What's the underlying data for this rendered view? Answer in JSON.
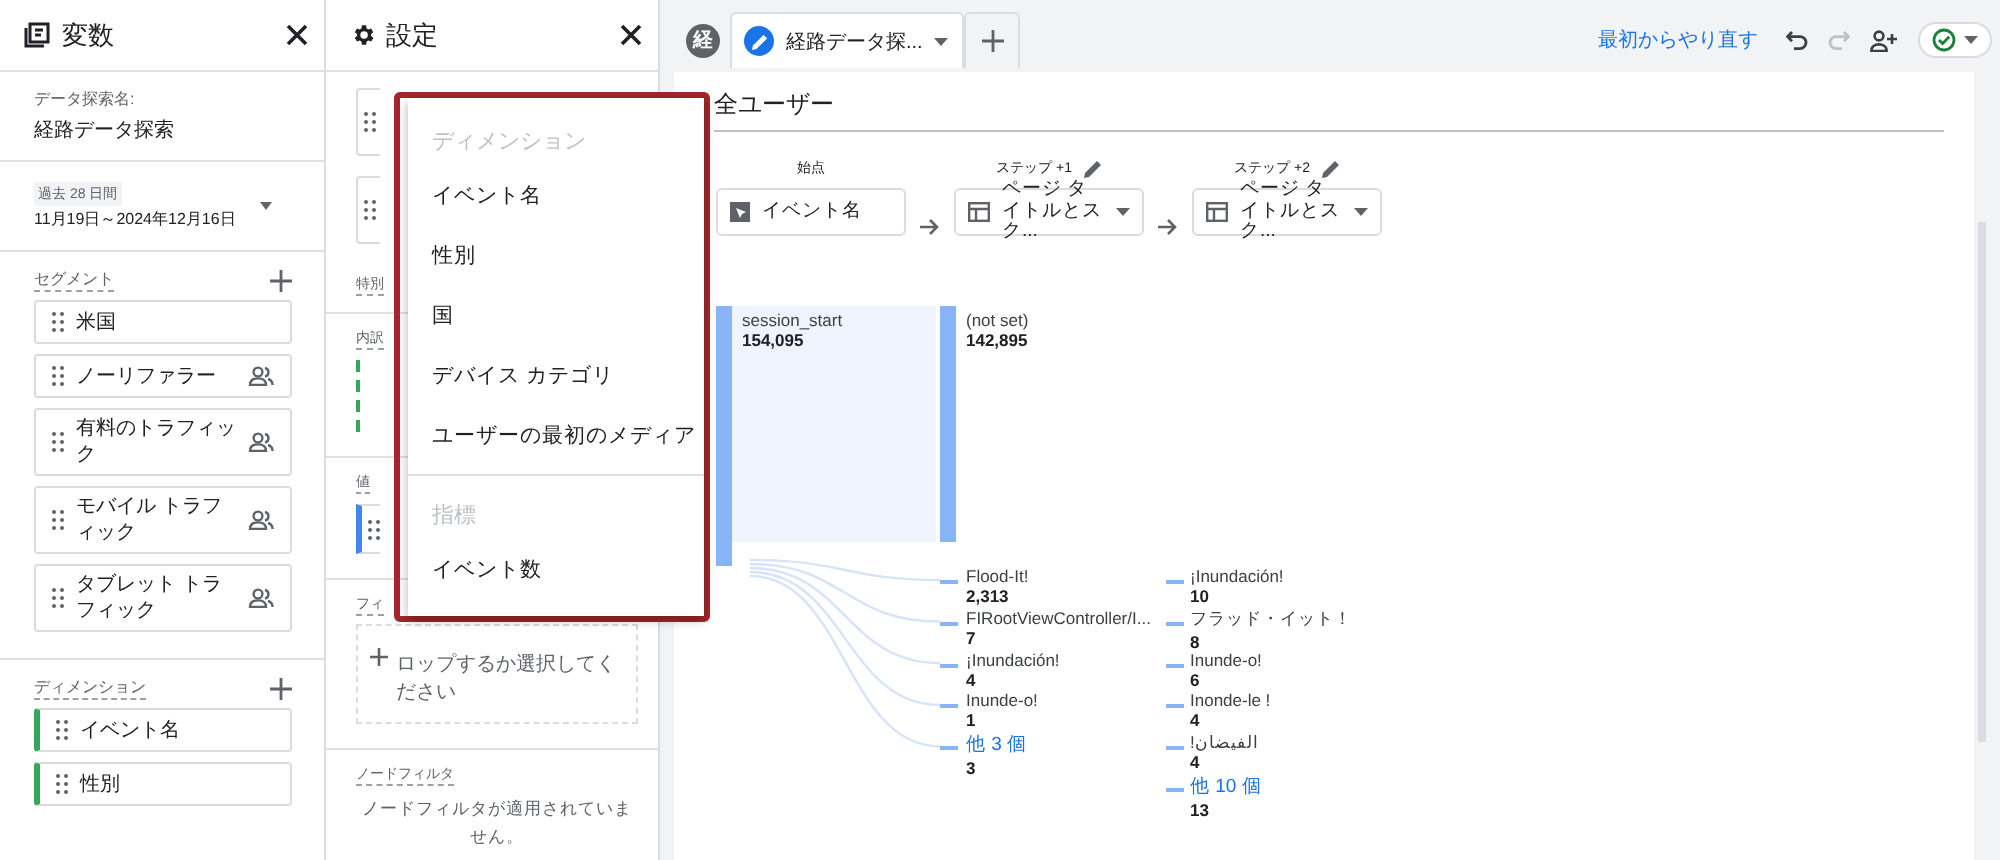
{
  "variables_panel": {
    "title": "変数",
    "exploration_name_label": "データ探索名:",
    "exploration_name": "経路データ探索",
    "date_range": {
      "preset": "過去 28 日間",
      "range": "11月19日～2024年12月16日"
    },
    "segments": {
      "label": "セグメント",
      "items": [
        {
          "label": "米国",
          "user_icon": false
        },
        {
          "label": "ノーリファラー",
          "user_icon": true
        },
        {
          "label": "有料のトラフィック",
          "user_icon": true
        },
        {
          "label": "モバイル トラフィック",
          "user_icon": true
        },
        {
          "label": "タブレット トラフィック",
          "user_icon": true
        }
      ]
    },
    "dimensions": {
      "label": "ディメンション",
      "items": [
        "イベント名",
        "性別"
      ]
    }
  },
  "settings_panel": {
    "title": "設定",
    "special_label": "特別",
    "breakdown_label": "内訳",
    "value_label": "値",
    "filter_label": "フィ",
    "filter_drop_text": "ロップするか選択してください",
    "node_filter_label": "ノードフィルタ",
    "node_filter_text": "ノードフィルタが適用されていません。"
  },
  "dropdown_menu": {
    "groups": [
      {
        "header": "ディメンション",
        "items": [
          "イベント名",
          "性別",
          "国",
          "デバイス カテゴリ",
          "ユーザーの最初のメディア"
        ]
      },
      {
        "header": "指標",
        "items": [
          "イベント数"
        ]
      }
    ]
  },
  "explore": {
    "badge": "経",
    "tabs": [
      {
        "label": "経路データ探...",
        "selected": true
      }
    ],
    "restart_link": "最初からやり直す",
    "segment_title": "全ユーザー",
    "steps": [
      {
        "label": "始点",
        "value": "イベント名",
        "editable": false,
        "kind": "event"
      },
      {
        "label": "ステップ +1",
        "value": "ページ タイトルとスク...",
        "editable": true,
        "kind": "page"
      },
      {
        "label": "ステップ +2",
        "value": "ページ タイトルとスク...",
        "editable": true,
        "kind": "page"
      }
    ],
    "columns": [
      [
        {
          "kind": "main",
          "label": "session_start",
          "value": "154,095"
        }
      ],
      [
        {
          "kind": "main",
          "label": "(not set)",
          "value": "142,895"
        },
        {
          "kind": "node",
          "label": "Flood-It!",
          "value": "2,313"
        },
        {
          "kind": "node",
          "label": "FIRootViewController/I...",
          "value": "7"
        },
        {
          "kind": "node",
          "label": "¡Inundación!",
          "value": "4"
        },
        {
          "kind": "node",
          "label": "Inunde-o!",
          "value": "1"
        },
        {
          "kind": "more",
          "label": "他 3 個",
          "value": "3"
        }
      ],
      [
        {
          "kind": "node",
          "label": "¡Inundación!",
          "value": "10"
        },
        {
          "kind": "node",
          "label": "フラッド・イット！",
          "value": "8"
        },
        {
          "kind": "node",
          "label": "Inunde-o!",
          "value": "6"
        },
        {
          "kind": "node",
          "label": "Inonde-le !",
          "value": "4"
        },
        {
          "kind": "node",
          "label": "!الفيضان",
          "value": "4"
        },
        {
          "kind": "more",
          "label": "他 10 個",
          "value": "13"
        }
      ]
    ]
  }
}
